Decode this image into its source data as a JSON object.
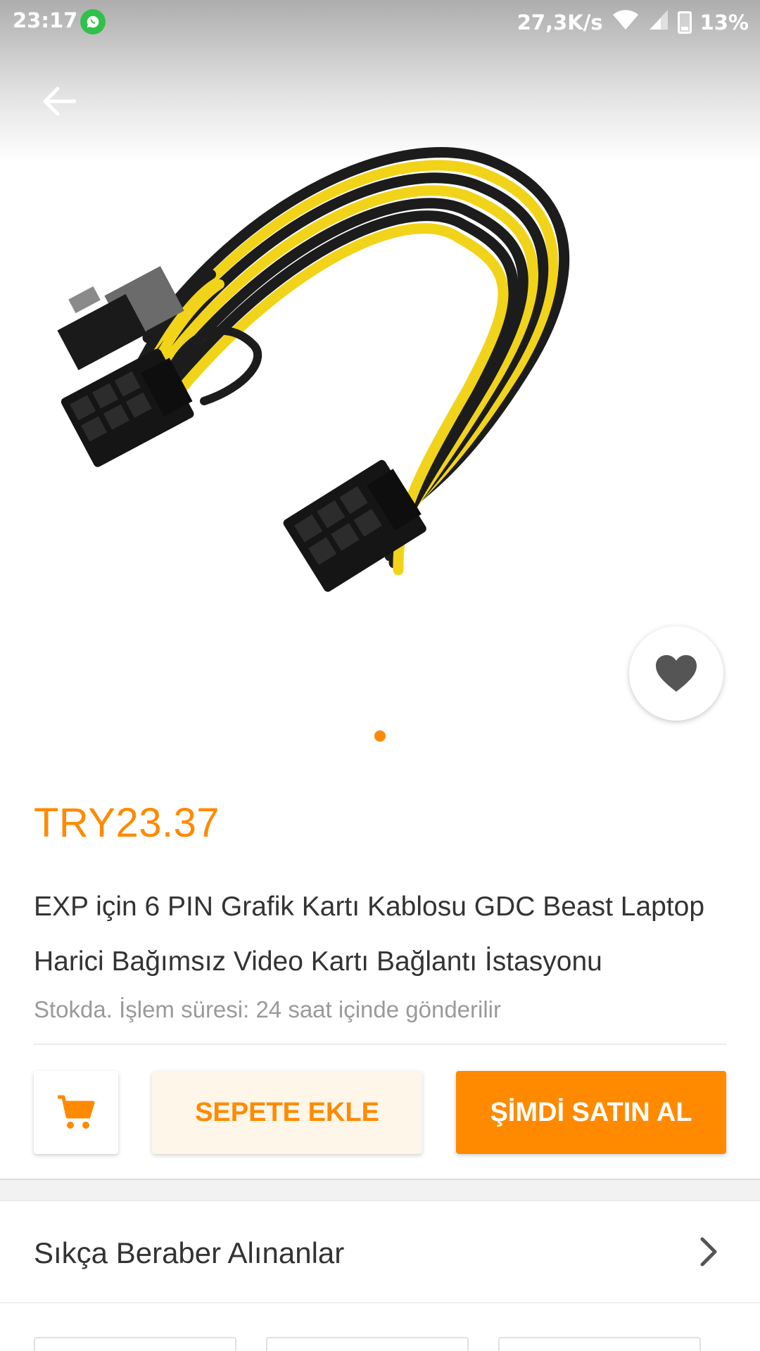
{
  "status_bar": {
    "time": "23:17",
    "network_speed": "27,3K/s",
    "battery": "13%"
  },
  "product": {
    "price": "TRY23.37",
    "title": "EXP için 6 PIN Grafik Kartı Kablosu GDC Beast Laptop Harici Bağımsız Video Kartı Bağlantı İstasyonu",
    "stock_info": "Stokda. İşlem süresi: 24 saat içinde gönderilir",
    "image_count": 1
  },
  "actions": {
    "add_to_cart": "SEPETE EKLE",
    "buy_now": "ŞİMDİ SATIN AL"
  },
  "sections": {
    "frequently_bought": "Sıkça Beraber Alınanlar"
  },
  "colors": {
    "accent": "#ff8a00",
    "whatsapp": "#2fc14b",
    "cable_yellow": "#f1d41a",
    "cable_black": "#1c1c1c"
  },
  "icons": [
    "back-arrow-icon",
    "heart-icon",
    "cart-icon",
    "chevron-right-icon",
    "whatsapp-icon",
    "wifi-icon",
    "signal-icon",
    "battery-icon"
  ]
}
